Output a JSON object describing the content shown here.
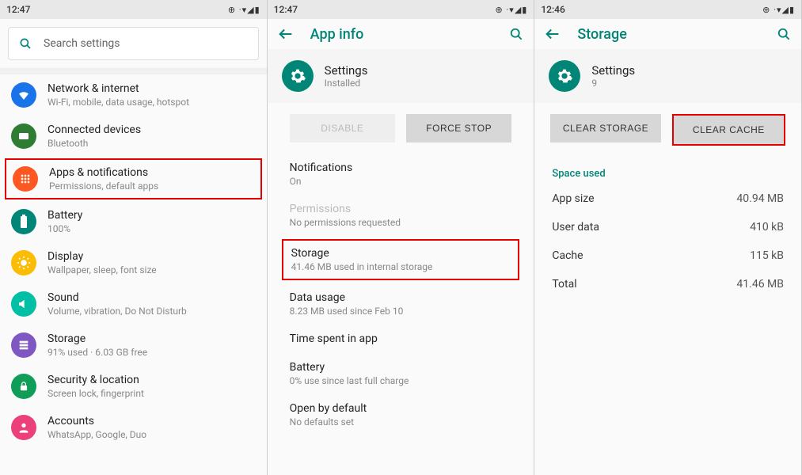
{
  "status": {
    "time1": "12:47",
    "time2": "12:47",
    "time3": "12:46"
  },
  "screen1": {
    "search_placeholder": "Search settings",
    "items": [
      {
        "title": "Network & internet",
        "subtitle": "Wi-Fi, mobile, data usage, hotspot"
      },
      {
        "title": "Connected devices",
        "subtitle": "Bluetooth"
      },
      {
        "title": "Apps & notifications",
        "subtitle": "Permissions, default apps"
      },
      {
        "title": "Battery",
        "subtitle": "100%"
      },
      {
        "title": "Display",
        "subtitle": "Wallpaper, sleep, font size"
      },
      {
        "title": "Sound",
        "subtitle": "Volume, vibration, Do Not Disturb"
      },
      {
        "title": "Storage",
        "subtitle": "91% used · 6.03 GB free"
      },
      {
        "title": "Security & location",
        "subtitle": "Screen lock, fingerprint"
      },
      {
        "title": "Accounts",
        "subtitle": "WhatsApp, Google, Duo"
      }
    ]
  },
  "screen2": {
    "title": "App info",
    "app_name": "Settings",
    "app_state": "Installed",
    "btn_disable": "DISABLE",
    "btn_force": "FORCE STOP",
    "rows": [
      {
        "title": "Notifications",
        "subtitle": "On"
      },
      {
        "title": "Permissions",
        "subtitle": "No permissions requested"
      },
      {
        "title": "Storage",
        "subtitle": "41.46 MB used in internal storage"
      },
      {
        "title": "Data usage",
        "subtitle": "8.23 MB used since Feb 10"
      },
      {
        "title": "Time spent in app",
        "subtitle": ""
      },
      {
        "title": "Battery",
        "subtitle": "0% use since last full charge"
      },
      {
        "title": "Open by default",
        "subtitle": "No defaults set"
      }
    ]
  },
  "screen3": {
    "title": "Storage",
    "app_name": "Settings",
    "app_line": "9",
    "btn_clear_storage": "CLEAR STORAGE",
    "btn_clear_cache": "CLEAR CACHE",
    "section": "Space used",
    "rows": [
      {
        "k": "App size",
        "v": "40.94 MB"
      },
      {
        "k": "User data",
        "v": "410 kB"
      },
      {
        "k": "Cache",
        "v": "115 kB"
      },
      {
        "k": "Total",
        "v": "41.46 MB"
      }
    ]
  }
}
